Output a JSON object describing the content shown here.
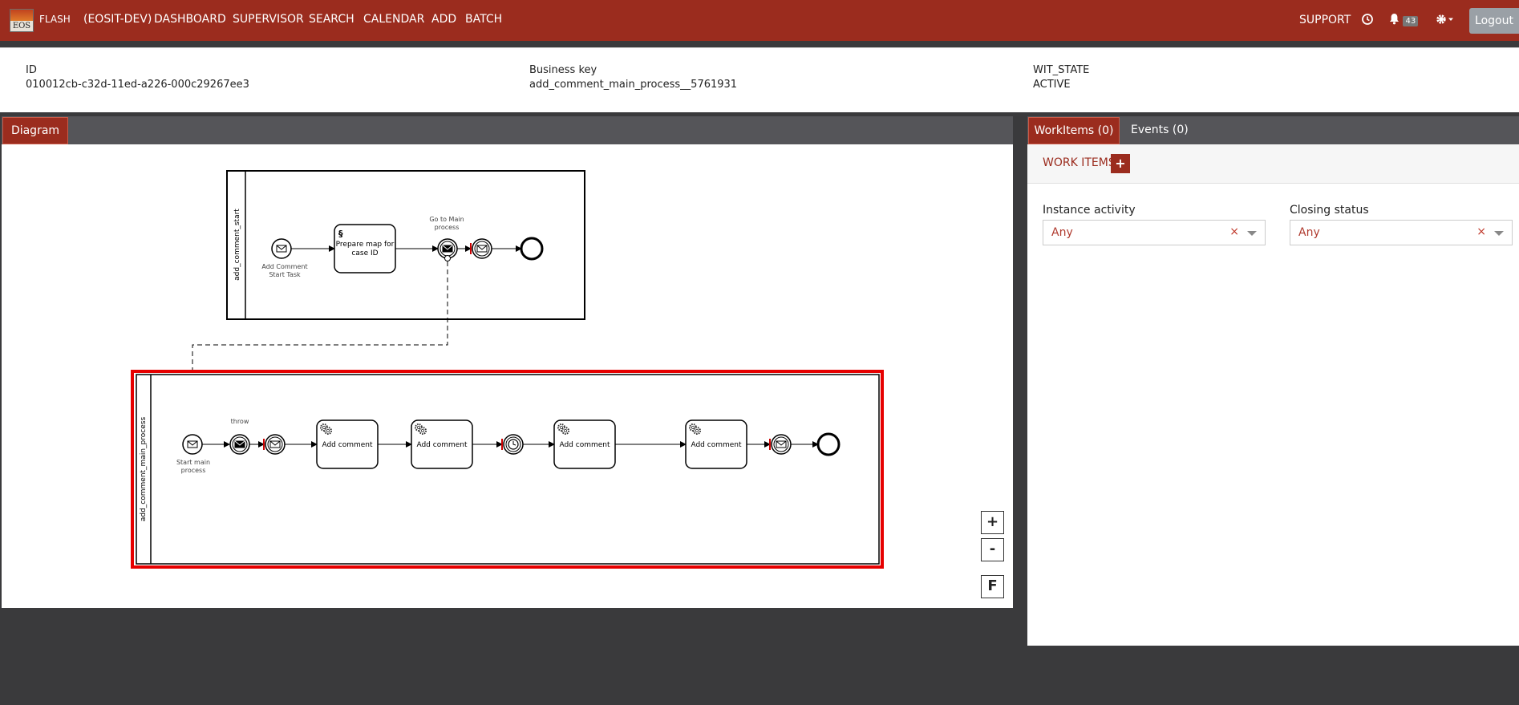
{
  "topbar": {
    "logo_text": "EOS",
    "brand": "FLASH",
    "nav": [
      "(EOSIT-DEV)",
      "DASHBOARD",
      "SUPERVISOR",
      "SEARCH",
      "CALENDAR",
      "ADD",
      "BATCH"
    ],
    "support": "SUPPORT",
    "notifications_count": "43",
    "logout": "Logout",
    "icons": {
      "history": "history-icon",
      "bell": "bell-icon",
      "settings": "gear-icon"
    },
    "accent_color": "#9b2c1e"
  },
  "info": {
    "id_label": "ID",
    "id_value": "010012cb-c32d-11ed-a226-000c29267ee3",
    "business_key_label": "Business key",
    "business_key_value": "add_comment_main_process__5761931",
    "state_label": "WIT_STATE",
    "state_value": "ACTIVE"
  },
  "left_tabs": {
    "diagram": "Diagram"
  },
  "diagram": {
    "pool_start": {
      "name": "add_comment_start",
      "start_event": "Add Comment Start Task",
      "task": "Prepare map for case ID",
      "catch_event": "Go to Main process"
    },
    "pool_main": {
      "name": "add_comment_main_process",
      "start_event": "Start main process",
      "throw_label": "throw",
      "tasks": [
        "Add comment",
        "Add comment",
        "Add comment",
        "Add comment"
      ]
    },
    "highlight_color": "#e60000",
    "zoom_in": "+",
    "zoom_out": "-",
    "fit": "F"
  },
  "right_tabs": {
    "workitems": "WorkItems (0)",
    "events": "Events (0)"
  },
  "workitems": {
    "title": "WORK ITEMS",
    "add": "+",
    "instance_activity_label": "Instance activity",
    "instance_activity_value": "Any",
    "closing_status_label": "Closing status",
    "closing_status_value": "Any",
    "clear": "×"
  }
}
